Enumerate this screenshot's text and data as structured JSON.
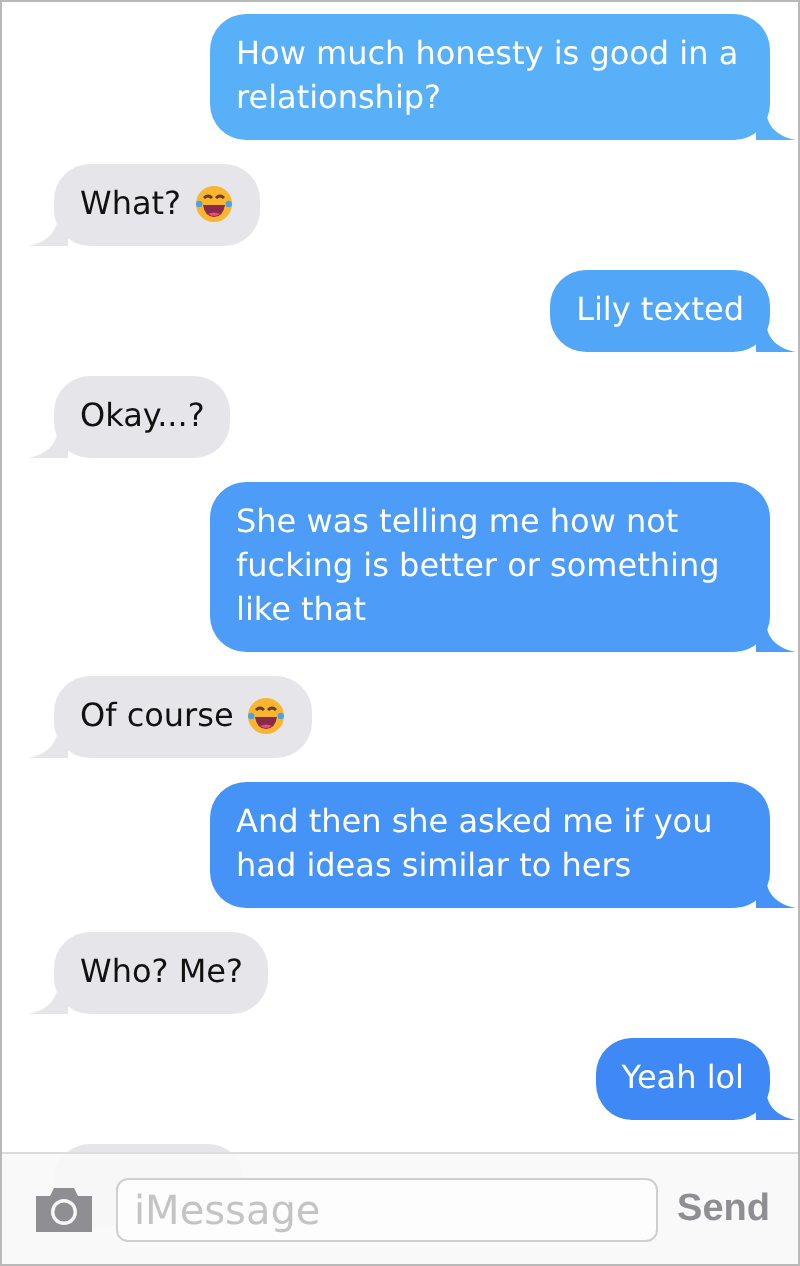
{
  "messages": [
    {
      "kind": "sent",
      "text": "How much honesty is good in a relationship?"
    },
    {
      "kind": "received",
      "text": "What?",
      "emoji": true
    },
    {
      "kind": "sent",
      "text": "Lily texted"
    },
    {
      "kind": "received",
      "text": "Okay...?"
    },
    {
      "kind": "sent",
      "text": "She was telling me how not fucking is better or something like that"
    },
    {
      "kind": "received",
      "text": "Of course",
      "emoji": true
    },
    {
      "kind": "sent",
      "text": "And then she asked me if you had ideas similar to hers"
    },
    {
      "kind": "received",
      "text": "Who? Me?"
    },
    {
      "kind": "sent",
      "text": "Yeah lol"
    },
    {
      "kind": "received"
    }
  ],
  "composer": {
    "placeholder": "iMessage",
    "send": "Send"
  }
}
